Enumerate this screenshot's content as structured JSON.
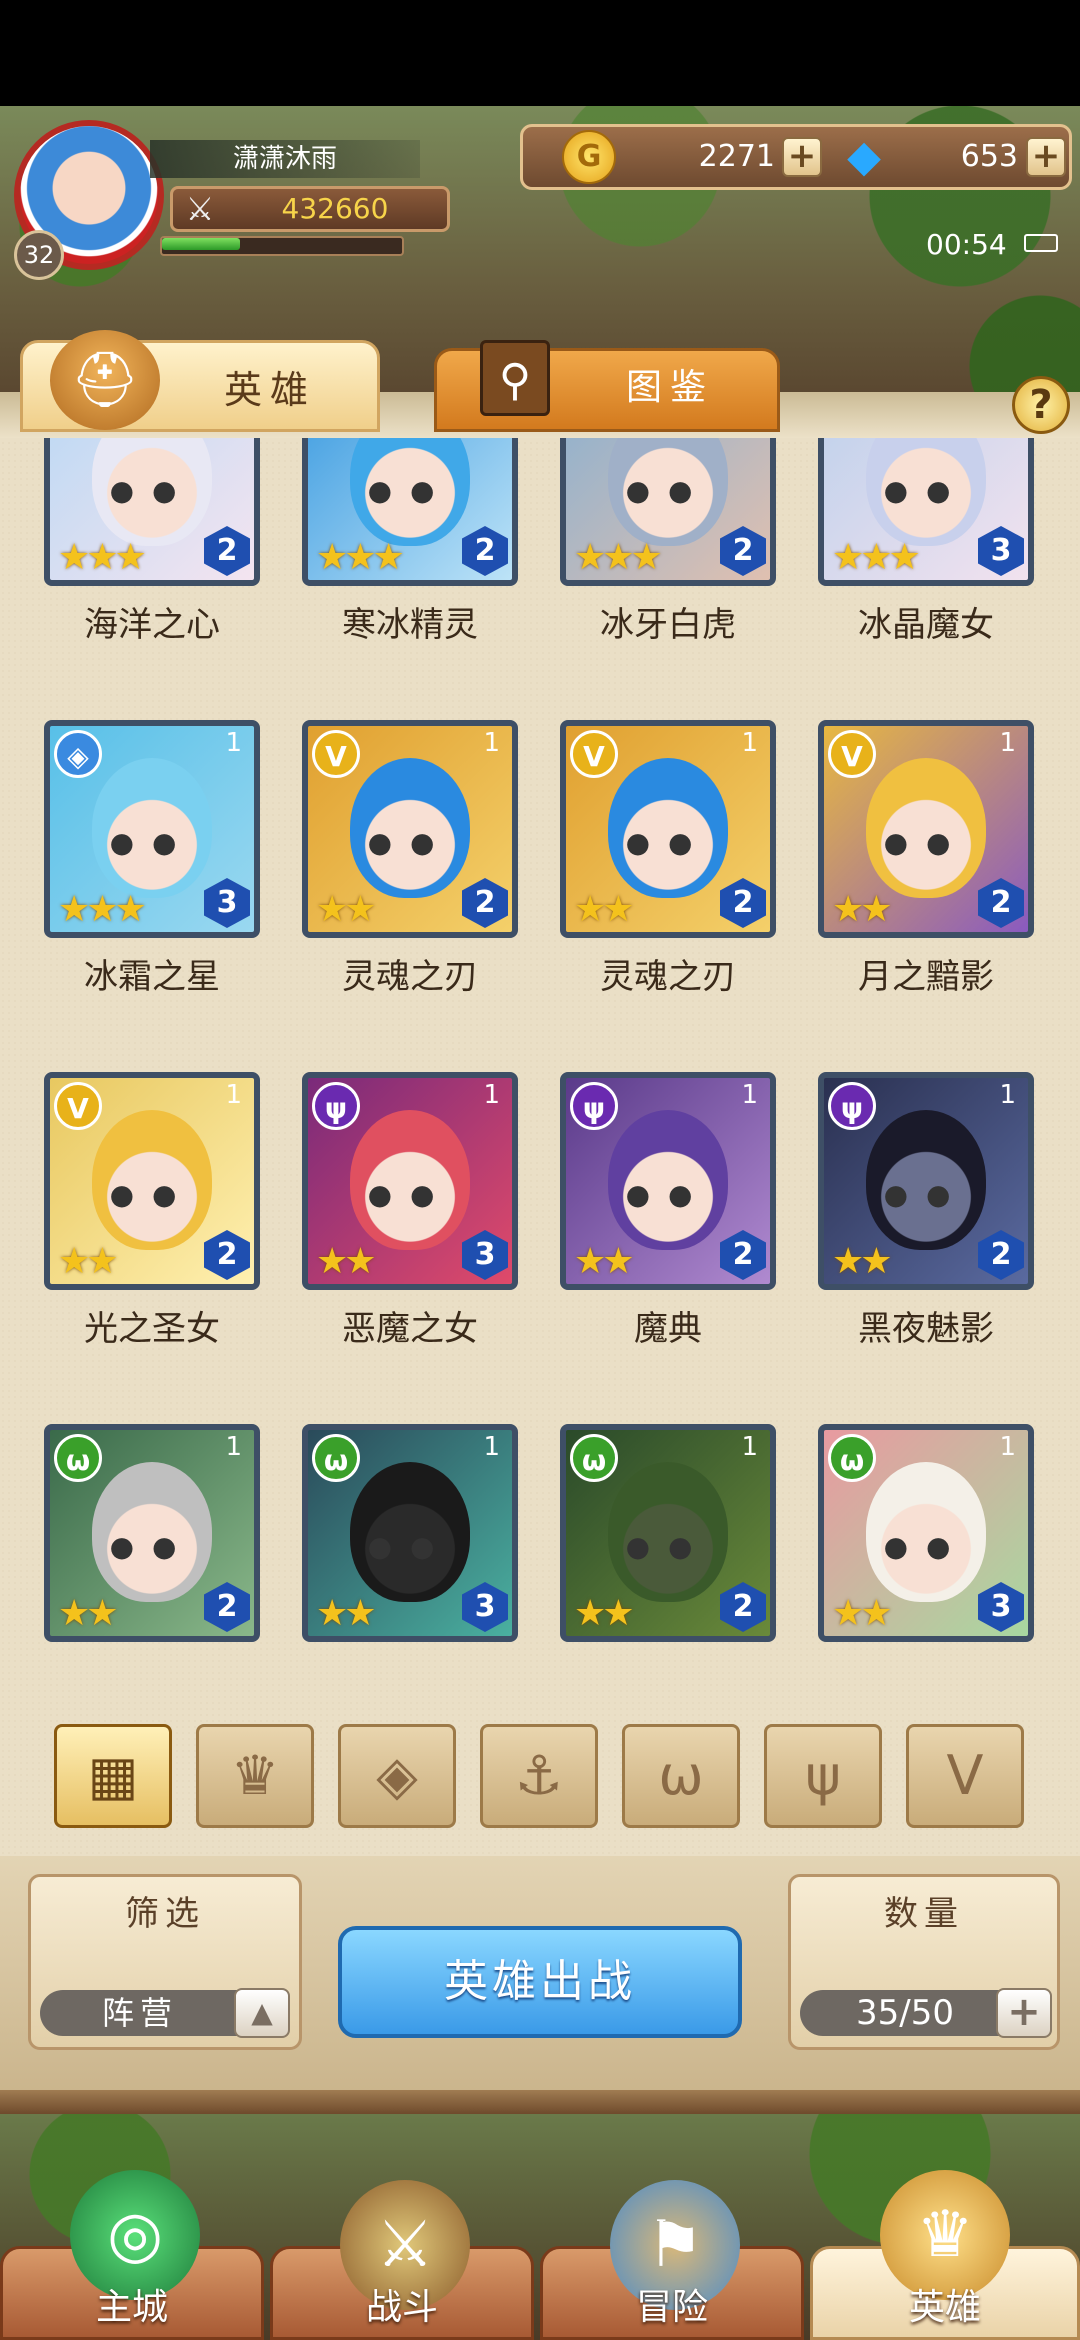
{
  "player": {
    "name": "潇潇沐雨",
    "level": "32",
    "power": "432660",
    "exp_fraction": 0.33
  },
  "currency": {
    "gold": "2271",
    "gems": "653",
    "plus": "+"
  },
  "clock": "00:54",
  "tabs": {
    "heroes": "英雄",
    "codex": "图鉴"
  },
  "help": "?",
  "heroes": [
    {
      "name": "海洋之心",
      "stars": "★★★",
      "level": "2",
      "tag": "",
      "count": ""
    },
    {
      "name": "寒冰精灵",
      "stars": "★★★",
      "level": "2",
      "tag": "",
      "count": ""
    },
    {
      "name": "冰牙白虎",
      "stars": "★★★",
      "level": "2",
      "tag": "",
      "count": ""
    },
    {
      "name": "冰晶魔女",
      "stars": "★★★",
      "level": "3",
      "tag": "",
      "count": ""
    },
    {
      "name": "冰霜之星",
      "stars": "★★★",
      "level": "3",
      "tag": "◈",
      "count": "1"
    },
    {
      "name": "灵魂之刃",
      "stars": "★★",
      "level": "2",
      "tag": "V",
      "count": "1"
    },
    {
      "name": "灵魂之刃",
      "stars": "★★",
      "level": "2",
      "tag": "V",
      "count": "1"
    },
    {
      "name": "月之黯影",
      "stars": "★★",
      "level": "2",
      "tag": "V",
      "count": "1"
    },
    {
      "name": "光之圣女",
      "stars": "★★",
      "level": "2",
      "tag": "V",
      "count": "1"
    },
    {
      "name": "恶魔之女",
      "stars": "★★",
      "level": "3",
      "tag": "ψ",
      "count": "1"
    },
    {
      "name": "魔典",
      "stars": "★★",
      "level": "2",
      "tag": "ψ",
      "count": "1"
    },
    {
      "name": "黑夜魅影",
      "stars": "★★",
      "level": "2",
      "tag": "ψ",
      "count": "1"
    },
    {
      "name": "",
      "stars": "★★",
      "level": "2",
      "tag": "ω",
      "count": "1"
    },
    {
      "name": "",
      "stars": "★★",
      "level": "3",
      "tag": "ω",
      "count": "1"
    },
    {
      "name": "",
      "stars": "★★",
      "level": "2",
      "tag": "ω",
      "count": "1"
    },
    {
      "name": "",
      "stars": "★★",
      "level": "3",
      "tag": "ω",
      "count": "1"
    }
  ],
  "factions": [
    "▦",
    "♛",
    "◈",
    "⚓",
    "ω",
    "ψ",
    "V"
  ],
  "filter": {
    "title": "筛选",
    "value": "阵营",
    "toggle": "▲"
  },
  "deploy_label": "英雄出战",
  "roster": {
    "title": "数量",
    "value": "35/50",
    "plus": "+"
  },
  "nav": [
    {
      "label": "主城",
      "icon": "◎"
    },
    {
      "label": "战斗",
      "icon": "⚔"
    },
    {
      "label": "冒险",
      "icon": "⚑"
    },
    {
      "label": "英雄",
      "icon": "♛"
    }
  ],
  "colors": {
    "level_badge": "#1f4fb0",
    "ice_tag": "#3a8ae0",
    "light_tag": "#e8b21a",
    "dark_tag": "#6a2ab0",
    "nature_tag": "#3aa02a",
    "deploy": "#3a9ae8"
  }
}
